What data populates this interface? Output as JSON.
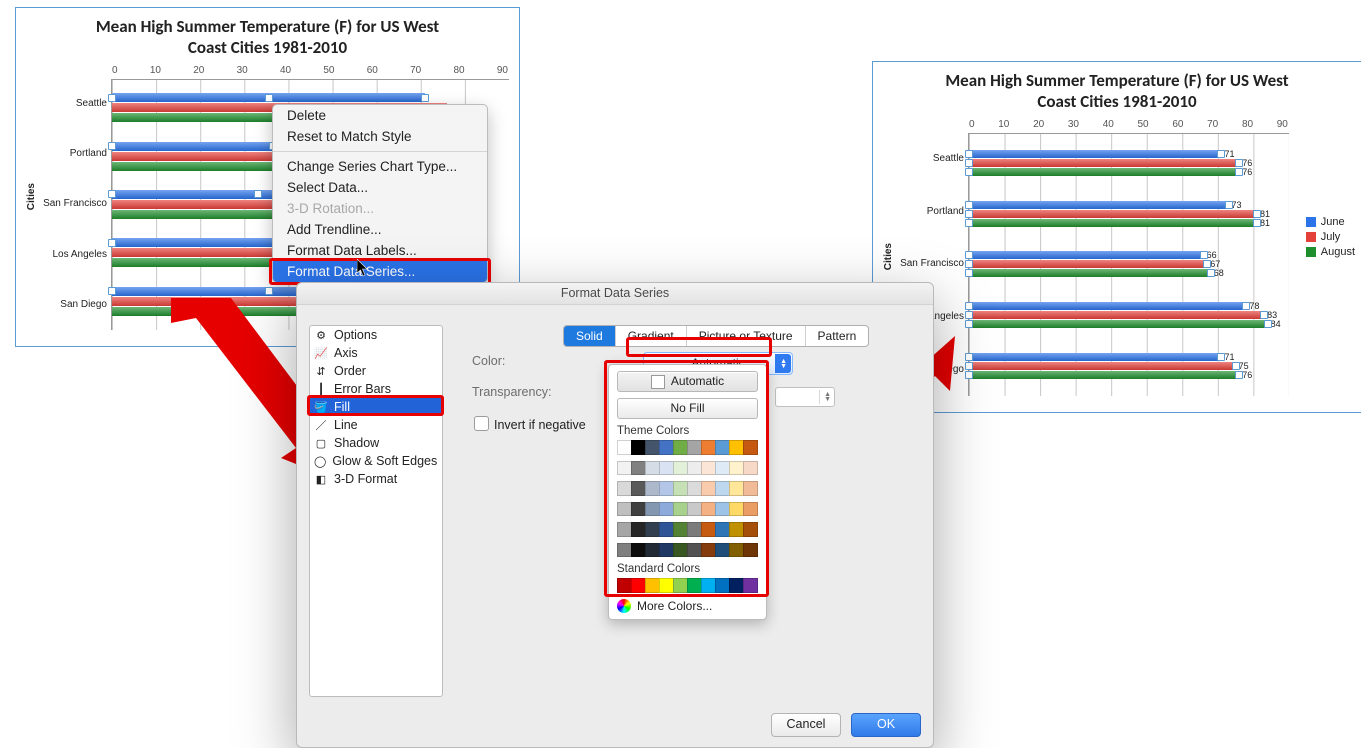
{
  "chart_data": {
    "type": "bar",
    "orientation": "horizontal",
    "title": "Mean High Summer Temperature (F) for US West Coast Cities 1981-2010",
    "ylabel": "Cities",
    "xlabel": "",
    "xlim": [
      0,
      90
    ],
    "xticks": [
      0,
      10,
      20,
      30,
      40,
      50,
      60,
      70,
      80,
      90
    ],
    "categories": [
      "Seattle",
      "Portland",
      "San Francisco",
      "Los Angeles",
      "San Diego"
    ],
    "series": [
      {
        "name": "June",
        "color": "#2b73e8",
        "values": [
          71,
          73,
          66,
          78,
          71
        ]
      },
      {
        "name": "July",
        "color": "#e5413b",
        "values": [
          76,
          81,
          67,
          83,
          75
        ]
      },
      {
        "name": "August",
        "color": "#1f8f2e",
        "values": [
          76,
          81,
          68,
          84,
          76
        ]
      }
    ],
    "legend": [
      "June",
      "July",
      "August"
    ],
    "legend_colors": [
      "#2b73e8",
      "#e5413b",
      "#1f8f2e"
    ]
  },
  "left_chart": {
    "bar_colors": [
      "#2b73e8",
      "#e5413b",
      "#1f8f2e"
    ],
    "show_handles": true
  },
  "context_menu": {
    "items": [
      {
        "label": "Delete",
        "disabled": false
      },
      {
        "label": "Reset to Match Style",
        "disabled": false
      },
      {
        "sep": true
      },
      {
        "label": "Change Series Chart Type...",
        "disabled": false
      },
      {
        "label": "Select Data...",
        "disabled": false
      },
      {
        "label": "3-D Rotation...",
        "disabled": true
      },
      {
        "label": "Add Trendline...",
        "disabled": false
      },
      {
        "label": "Format Data Labels...",
        "disabled": false
      },
      {
        "label": "Format Data Series...",
        "disabled": false,
        "selected": true
      }
    ]
  },
  "dialog": {
    "title": "Format Data Series",
    "side_items": [
      "Options",
      "Axis",
      "Order",
      "Error Bars",
      "Fill",
      "Line",
      "Shadow",
      "Glow & Soft Edges",
      "3-D Format"
    ],
    "side_selected": "Fill",
    "tabs": [
      "Solid",
      "Gradient",
      "Picture or Texture",
      "Pattern"
    ],
    "tab_active": "Solid",
    "color_label": "Color:",
    "transparency_label": "Transparency:",
    "invert_label": "Invert if negative",
    "dropdown_value": "Automatic",
    "cancel": "Cancel",
    "ok": "OK"
  },
  "color_popup": {
    "automatic": "Automatic",
    "no_fill": "No Fill",
    "theme_title": "Theme Colors",
    "theme_row": [
      "#ffffff",
      "#000000",
      "#44546a",
      "#4472c4",
      "#70ad47",
      "#a5a5a5",
      "#ed7d31",
      "#5b9bd5",
      "#ffc000",
      "#c65911"
    ],
    "theme_variants": [
      [
        "#f2f2f2",
        "#808080",
        "#d6dce5",
        "#d9e2f3",
        "#e2f0d9",
        "#ededed",
        "#fbe5d6",
        "#deebf7",
        "#fff2cc",
        "#f7d9c8"
      ],
      [
        "#d9d9d9",
        "#595959",
        "#adb9ca",
        "#b4c6e7",
        "#c5e0b4",
        "#dbdbdb",
        "#f8cbad",
        "#bdd7ee",
        "#ffe699",
        "#f1bb97"
      ],
      [
        "#bfbfbf",
        "#404040",
        "#8497b0",
        "#8eaadb",
        "#a9d18e",
        "#c9c9c9",
        "#f4b183",
        "#9dc3e6",
        "#ffd966",
        "#eb9d66"
      ],
      [
        "#a6a6a6",
        "#262626",
        "#323f4f",
        "#2f5597",
        "#548235",
        "#7b7b7b",
        "#c55a11",
        "#2e75b6",
        "#bf9000",
        "#a4500a"
      ],
      [
        "#7f7f7f",
        "#0d0d0d",
        "#222a35",
        "#1f3864",
        "#385723",
        "#525252",
        "#843c0c",
        "#1f4e79",
        "#806000",
        "#6e3507"
      ]
    ],
    "standard_title": "Standard Colors",
    "standard_row": [
      "#c00000",
      "#ff0000",
      "#ffc000",
      "#ffff00",
      "#92d050",
      "#00b050",
      "#00b0f0",
      "#0070c0",
      "#002060",
      "#7030a0"
    ],
    "more": "More Colors..."
  }
}
